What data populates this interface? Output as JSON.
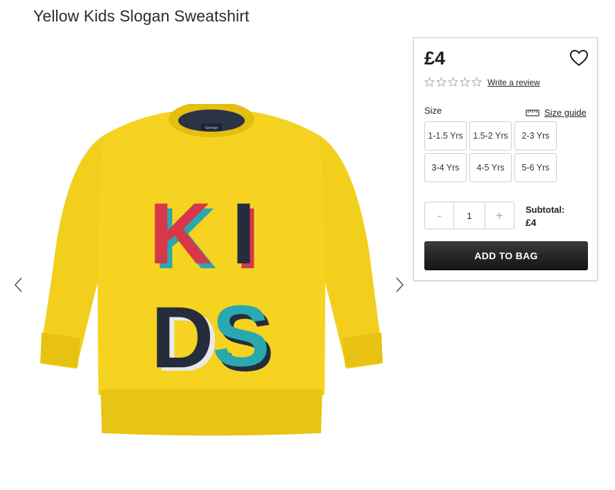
{
  "product": {
    "title": "Yellow Kids Slogan Sweatshirt",
    "price": "£4",
    "garment_color": "#F2CF1D"
  },
  "gallery": {
    "print_letters": [
      "K",
      "I",
      "D",
      "S"
    ],
    "label_text": "George",
    "prev_icon": "chevron-left-icon",
    "next_icon": "chevron-right-icon"
  },
  "rating": {
    "stars": 5,
    "filled": 0,
    "write_review_label": "Write a review"
  },
  "size": {
    "label": "Size",
    "guide_label": "Size guide",
    "options": [
      "1-1.5 Yrs",
      "1.5-2 Yrs",
      "2-3 Yrs",
      "3-4 Yrs",
      "4-5 Yrs",
      "5-6 Yrs"
    ]
  },
  "quantity": {
    "decrement": "-",
    "value": "1",
    "increment": "+"
  },
  "subtotal": {
    "label": "Subtotal:",
    "value": "£4"
  },
  "actions": {
    "add_to_bag": "ADD TO BAG"
  }
}
